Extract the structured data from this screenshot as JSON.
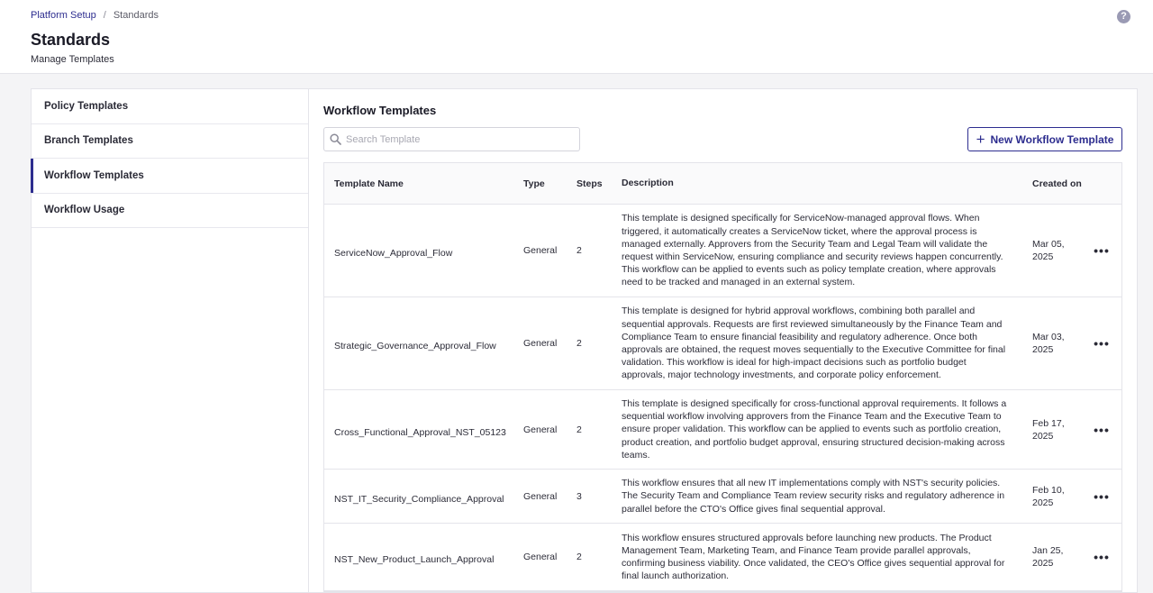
{
  "breadcrumb": {
    "parent": "Platform Setup",
    "separator": "/",
    "current": "Standards"
  },
  "page": {
    "title": "Standards",
    "subtitle": "Manage Templates",
    "help_icon": "question-circle-icon"
  },
  "sidebar": {
    "items": [
      {
        "label": "Policy Templates",
        "active": false
      },
      {
        "label": "Branch Templates",
        "active": false
      },
      {
        "label": "Workflow Templates",
        "active": true
      },
      {
        "label": "Workflow Usage",
        "active": false
      }
    ]
  },
  "main": {
    "title": "Workflow Templates",
    "search": {
      "placeholder": "Search Template",
      "value": "",
      "icon": "search-icon"
    },
    "new_button": {
      "label": "New Workflow Template",
      "icon": "plus-icon"
    }
  },
  "table": {
    "columns": {
      "name": "Template Name",
      "type": "Type",
      "steps": "Steps",
      "description": "Description",
      "created": "Created on"
    },
    "rows": [
      {
        "name": "ServiceNow_Approval_Flow",
        "type": "General",
        "steps": "2",
        "description": "This template is designed specifically for ServiceNow-managed approval flows. When triggered, it automatically creates a ServiceNow ticket, where the approval process is managed externally. Approvers from the Security Team and Legal Team will validate the request within ServiceNow, ensuring compliance and security reviews happen concurrently. This workflow can be applied to events such as policy template creation, where approvals need to be tracked and managed in an external system.",
        "created": "Mar 05, 2025",
        "action_icon": "more-horizontal-icon"
      },
      {
        "name": "Strategic_Governance_Approval_Flow",
        "type": "General",
        "steps": "2",
        "description": "This template is designed for hybrid approval workflows, combining both parallel and sequential approvals. Requests are first reviewed simultaneously by the Finance Team and Compliance Team to ensure financial feasibility and regulatory adherence. Once both approvals are obtained, the request moves sequentially to the Executive Committee for final validation. This workflow is ideal for high-impact decisions such as portfolio budget approvals, major technology investments, and corporate policy enforcement.",
        "created": "Mar 03, 2025",
        "action_icon": "more-horizontal-icon"
      },
      {
        "name": "Cross_Functional_Approval_NST_05123",
        "type": "General",
        "steps": "2",
        "description": "This template is designed specifically for cross-functional approval requirements. It follows a sequential workflow involving approvers from the Finance Team and the Executive Team to ensure proper validation. This workflow can be applied to events such as portfolio creation, product creation, and portfolio budget approval, ensuring structured decision-making across teams.",
        "created": "Feb 17, 2025",
        "action_icon": "more-horizontal-icon"
      },
      {
        "name": "NST_IT_Security_Compliance_Approval",
        "type": "General",
        "steps": "3",
        "description": "This workflow ensures that all new IT implementations comply with NST's security policies. The Security Team and Compliance Team review security risks and regulatory adherence in parallel before the CTO's Office gives final sequential approval.",
        "created": "Feb 10, 2025",
        "action_icon": "more-horizontal-icon"
      },
      {
        "name": "NST_New_Product_Launch_Approval",
        "type": "General",
        "steps": "2",
        "description": "This workflow ensures structured approvals before launching new products. The Product Management Team, Marketing Team, and Finance Team provide parallel approvals, confirming business viability. Once validated, the CEO's Office gives sequential approval for final launch authorization.",
        "created": "Jan 25, 2025",
        "action_icon": "more-horizontal-icon"
      }
    ]
  }
}
